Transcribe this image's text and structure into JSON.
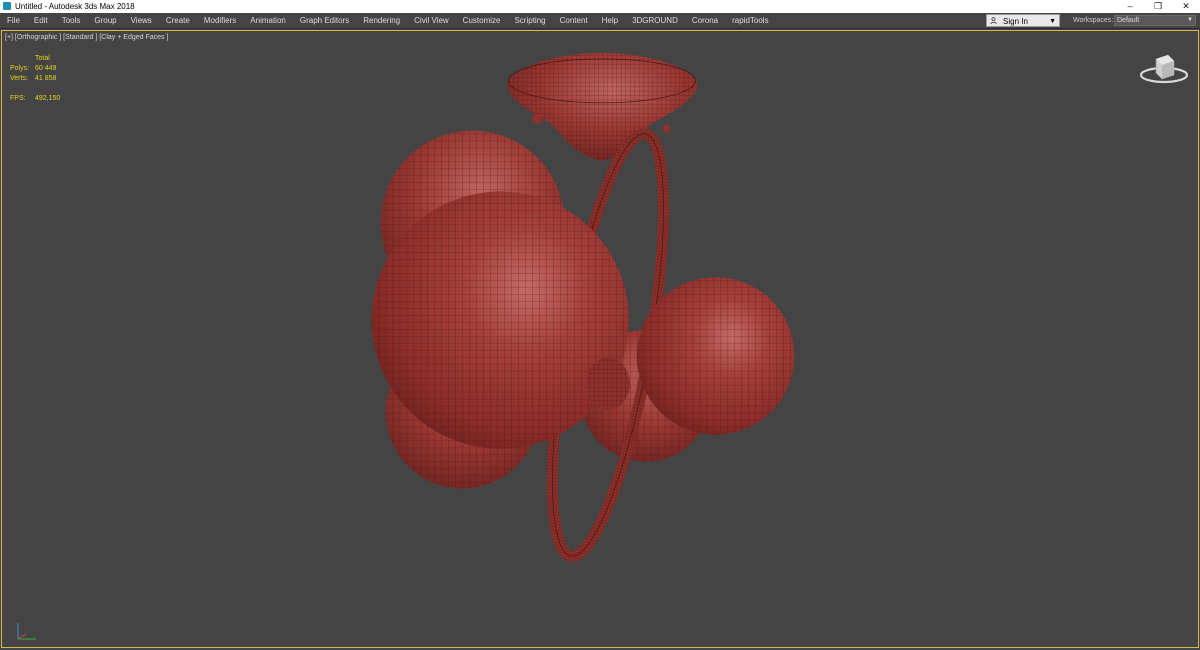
{
  "window": {
    "title": "Untitled - Autodesk 3ds Max 2018",
    "controls": {
      "minimize": "–",
      "restore": "❐",
      "close": "✕"
    }
  },
  "menu": [
    "File",
    "Edit",
    "Tools",
    "Group",
    "Views",
    "Create",
    "Modifiers",
    "Animation",
    "Graph Editors",
    "Rendering",
    "Civil View",
    "Customize",
    "Scripting",
    "Content",
    "Help",
    "3DGROUND",
    "Corona",
    "rapidTools"
  ],
  "signin": {
    "label": "Sign In",
    "caret": "▼"
  },
  "workspaces": {
    "label": "Workspaces:",
    "value": "Default",
    "caret": "▼"
  },
  "viewport": {
    "label": "[+] [Orthographic ] [Standard ] [Clay + Edged Faces ]",
    "stats": {
      "header": "Total",
      "polys_label": "Polys:",
      "polys": "60 449",
      "verts_label": "Verts:",
      "verts": "41 858",
      "fps_label": "FPS:",
      "fps": "492,150"
    }
  },
  "colors": {
    "viewport_bg": "#444444",
    "model": "#a13530",
    "stats_text": "#e6d21f",
    "viewport_border": "#d9b44a"
  },
  "icons": {
    "viewcube": "viewcube-icon",
    "user": "user-icon",
    "axis": "axis-tripod-icon",
    "app": "3dsmax-app-icon"
  }
}
